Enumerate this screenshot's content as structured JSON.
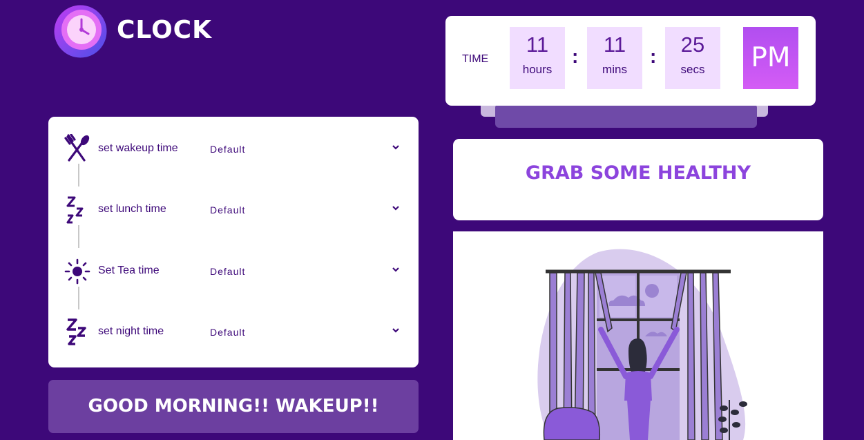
{
  "app": {
    "title": "CLOCK"
  },
  "clock": {
    "label": "TIME",
    "hours": "11",
    "hours_label": "hours",
    "mins": "11",
    "mins_label": "mins",
    "secs": "25",
    "secs_label": "secs",
    "ampm": "PM",
    "separator": ":"
  },
  "schedule": {
    "items": [
      {
        "label": "set wakeup time",
        "value": "Default",
        "icon": "fork-spoon-icon"
      },
      {
        "label": "set lunch time",
        "value": "Default",
        "icon": "zzz-icon"
      },
      {
        "label": "Set Tea time",
        "value": "Default",
        "icon": "sun-icon"
      },
      {
        "label": "set night time",
        "value": "Default",
        "icon": "zzz-icon"
      }
    ]
  },
  "wake_button": {
    "label": "GOOD MORNING!! WAKEUP!!"
  },
  "message": {
    "text": "GRAB SOME HEALTHY BREAKFAST!!!"
  },
  "colors": {
    "background": "#3d0879",
    "accent": "#8c44dd",
    "ampm": "#c454f3"
  }
}
